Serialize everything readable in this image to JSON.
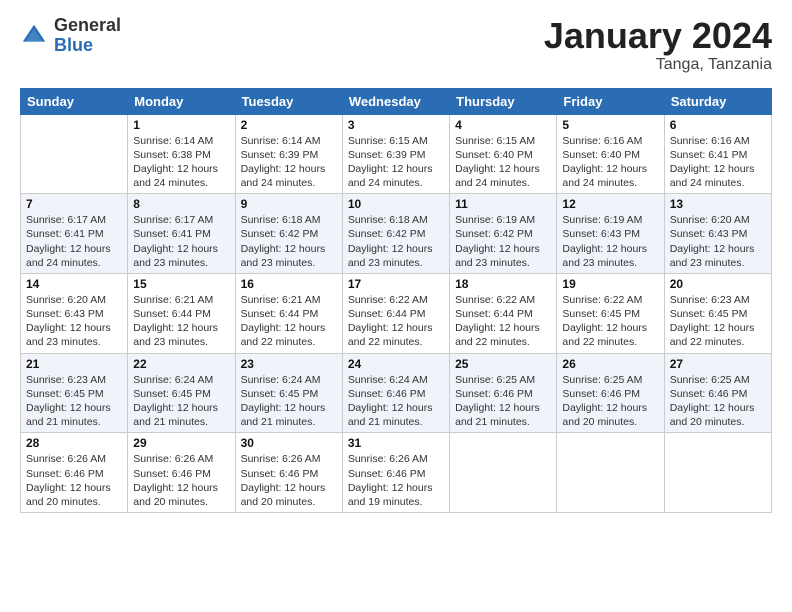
{
  "logo": {
    "general": "General",
    "blue": "Blue"
  },
  "title": "January 2024",
  "location": "Tanga, Tanzania",
  "days_header": [
    "Sunday",
    "Monday",
    "Tuesday",
    "Wednesday",
    "Thursday",
    "Friday",
    "Saturday"
  ],
  "weeks": [
    [
      {
        "day": "",
        "detail": ""
      },
      {
        "day": "1",
        "detail": "Sunrise: 6:14 AM\nSunset: 6:38 PM\nDaylight: 12 hours\nand 24 minutes."
      },
      {
        "day": "2",
        "detail": "Sunrise: 6:14 AM\nSunset: 6:39 PM\nDaylight: 12 hours\nand 24 minutes."
      },
      {
        "day": "3",
        "detail": "Sunrise: 6:15 AM\nSunset: 6:39 PM\nDaylight: 12 hours\nand 24 minutes."
      },
      {
        "day": "4",
        "detail": "Sunrise: 6:15 AM\nSunset: 6:40 PM\nDaylight: 12 hours\nand 24 minutes."
      },
      {
        "day": "5",
        "detail": "Sunrise: 6:16 AM\nSunset: 6:40 PM\nDaylight: 12 hours\nand 24 minutes."
      },
      {
        "day": "6",
        "detail": "Sunrise: 6:16 AM\nSunset: 6:41 PM\nDaylight: 12 hours\nand 24 minutes."
      }
    ],
    [
      {
        "day": "7",
        "detail": "Sunrise: 6:17 AM\nSunset: 6:41 PM\nDaylight: 12 hours\nand 24 minutes."
      },
      {
        "day": "8",
        "detail": "Sunrise: 6:17 AM\nSunset: 6:41 PM\nDaylight: 12 hours\nand 23 minutes."
      },
      {
        "day": "9",
        "detail": "Sunrise: 6:18 AM\nSunset: 6:42 PM\nDaylight: 12 hours\nand 23 minutes."
      },
      {
        "day": "10",
        "detail": "Sunrise: 6:18 AM\nSunset: 6:42 PM\nDaylight: 12 hours\nand 23 minutes."
      },
      {
        "day": "11",
        "detail": "Sunrise: 6:19 AM\nSunset: 6:42 PM\nDaylight: 12 hours\nand 23 minutes."
      },
      {
        "day": "12",
        "detail": "Sunrise: 6:19 AM\nSunset: 6:43 PM\nDaylight: 12 hours\nand 23 minutes."
      },
      {
        "day": "13",
        "detail": "Sunrise: 6:20 AM\nSunset: 6:43 PM\nDaylight: 12 hours\nand 23 minutes."
      }
    ],
    [
      {
        "day": "14",
        "detail": "Sunrise: 6:20 AM\nSunset: 6:43 PM\nDaylight: 12 hours\nand 23 minutes."
      },
      {
        "day": "15",
        "detail": "Sunrise: 6:21 AM\nSunset: 6:44 PM\nDaylight: 12 hours\nand 23 minutes."
      },
      {
        "day": "16",
        "detail": "Sunrise: 6:21 AM\nSunset: 6:44 PM\nDaylight: 12 hours\nand 22 minutes."
      },
      {
        "day": "17",
        "detail": "Sunrise: 6:22 AM\nSunset: 6:44 PM\nDaylight: 12 hours\nand 22 minutes."
      },
      {
        "day": "18",
        "detail": "Sunrise: 6:22 AM\nSunset: 6:44 PM\nDaylight: 12 hours\nand 22 minutes."
      },
      {
        "day": "19",
        "detail": "Sunrise: 6:22 AM\nSunset: 6:45 PM\nDaylight: 12 hours\nand 22 minutes."
      },
      {
        "day": "20",
        "detail": "Sunrise: 6:23 AM\nSunset: 6:45 PM\nDaylight: 12 hours\nand 22 minutes."
      }
    ],
    [
      {
        "day": "21",
        "detail": "Sunrise: 6:23 AM\nSunset: 6:45 PM\nDaylight: 12 hours\nand 21 minutes."
      },
      {
        "day": "22",
        "detail": "Sunrise: 6:24 AM\nSunset: 6:45 PM\nDaylight: 12 hours\nand 21 minutes."
      },
      {
        "day": "23",
        "detail": "Sunrise: 6:24 AM\nSunset: 6:45 PM\nDaylight: 12 hours\nand 21 minutes."
      },
      {
        "day": "24",
        "detail": "Sunrise: 6:24 AM\nSunset: 6:46 PM\nDaylight: 12 hours\nand 21 minutes."
      },
      {
        "day": "25",
        "detail": "Sunrise: 6:25 AM\nSunset: 6:46 PM\nDaylight: 12 hours\nand 21 minutes."
      },
      {
        "day": "26",
        "detail": "Sunrise: 6:25 AM\nSunset: 6:46 PM\nDaylight: 12 hours\nand 20 minutes."
      },
      {
        "day": "27",
        "detail": "Sunrise: 6:25 AM\nSunset: 6:46 PM\nDaylight: 12 hours\nand 20 minutes."
      }
    ],
    [
      {
        "day": "28",
        "detail": "Sunrise: 6:26 AM\nSunset: 6:46 PM\nDaylight: 12 hours\nand 20 minutes."
      },
      {
        "day": "29",
        "detail": "Sunrise: 6:26 AM\nSunset: 6:46 PM\nDaylight: 12 hours\nand 20 minutes."
      },
      {
        "day": "30",
        "detail": "Sunrise: 6:26 AM\nSunset: 6:46 PM\nDaylight: 12 hours\nand 20 minutes."
      },
      {
        "day": "31",
        "detail": "Sunrise: 6:26 AM\nSunset: 6:46 PM\nDaylight: 12 hours\nand 19 minutes."
      },
      {
        "day": "",
        "detail": ""
      },
      {
        "day": "",
        "detail": ""
      },
      {
        "day": "",
        "detail": ""
      }
    ]
  ]
}
